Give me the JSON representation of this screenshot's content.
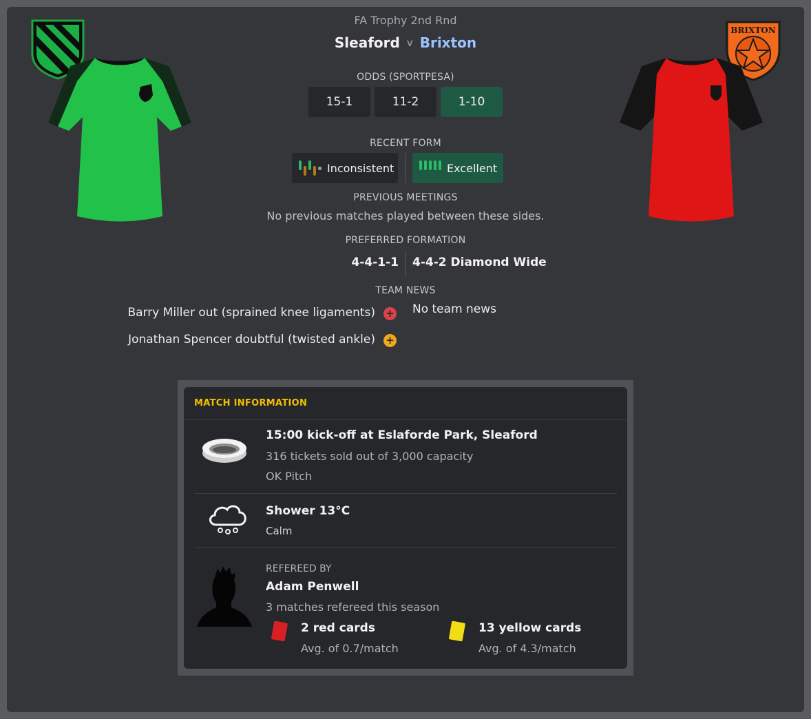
{
  "match": {
    "competition": "FA Trophy 2nd Rnd",
    "home_team": "Sleaford",
    "vs": "v",
    "away_team": "Brixton"
  },
  "away_badge_text": "BRIXTON",
  "odds": {
    "label": "ODDS (SPORTPESA)",
    "home": "15-1",
    "draw": "11-2",
    "away": "1-10"
  },
  "recent_form": {
    "label": "RECENT FORM",
    "home": "Inconsistent",
    "away": "Excellent"
  },
  "previous_meetings": {
    "label": "PREVIOUS MEETINGS",
    "text": "No previous matches played between these sides."
  },
  "preferred_formation": {
    "label": "PREFERRED FORMATION",
    "home": "4-4-1-1",
    "away": "4-4-2 Diamond Wide"
  },
  "team_news": {
    "label": "TEAM NEWS",
    "home": [
      {
        "text": "Barry Miller out (sprained knee ligaments)",
        "icon": "injury-out-icon",
        "color": "#d9434a"
      },
      {
        "text": "Jonathan Spencer doubtful (twisted ankle)",
        "icon": "injury-doubt-icon",
        "color": "#f0a81c"
      }
    ],
    "away": "No team news"
  },
  "match_information": {
    "title": "MATCH INFORMATION",
    "venue": {
      "kickoff": "15:00 kick-off at Eslaforde Park, Sleaford",
      "tickets": "316 tickets sold out of 3,000 capacity",
      "pitch": "OK Pitch"
    },
    "weather": {
      "condition": "Shower 13°C",
      "wind": "Calm"
    },
    "referee": {
      "label": "REFEREED BY",
      "name": "Adam Penwell",
      "matches": "3 matches refereed this season",
      "red_cards": "2 red cards",
      "red_avg": "Avg. of 0.7/match",
      "yellow_cards": "13 yellow cards",
      "yellow_avg": "Avg. of 4.3/match"
    }
  },
  "colors": {
    "home_kit": "#22c24a",
    "away_kit": "#e01515",
    "accent_title": "#f0c000",
    "favourite_green": "#1e5a43",
    "away_link": "#9bc4ff"
  }
}
